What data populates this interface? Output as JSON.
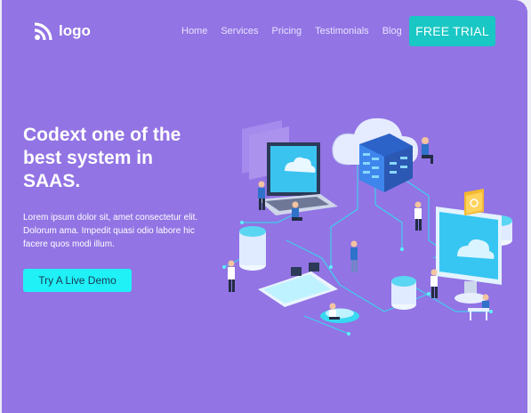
{
  "header": {
    "logo_text": "logo",
    "logo_icon": "wifi-signal-icon",
    "nav": [
      "Home",
      "Services",
      "Pricing",
      "Testimonials",
      "Blog"
    ],
    "cta_label": "FREE TRIAL"
  },
  "hero": {
    "title": "Codext one of the best system in SAAS.",
    "description": "Lorem ipsum dolor sit, amet consectetur elit. Dolorum ama. Impedit quasi odio labore hic facere quos modi illum.",
    "button_label": "Try A Live Demo"
  },
  "colors": {
    "background": "#9274e4",
    "accent": "#19c7c4",
    "demo_button": "#1ff1f6"
  }
}
